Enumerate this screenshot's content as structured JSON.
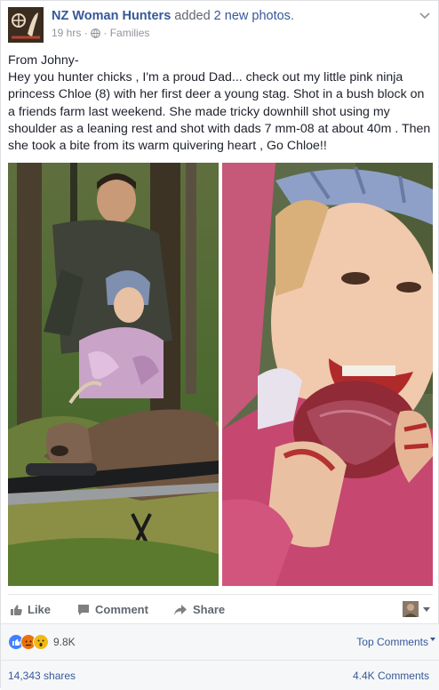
{
  "post": {
    "page_name": "NZ Woman Hunters",
    "verb": " added ",
    "count_text": "2 new photos",
    "period": ".",
    "time": "19 hrs",
    "sep": " · ",
    "audience": " · Families",
    "text_lines": [
      "From Johny-",
      "Hey you hunter chicks , I'm a proud Dad... check out my little pink ninja princess Chloe (8) with her first deer a young stag. Shot in a bush block on a friends farm last weekend. She made tricky downhill shot using my shoulder as a leaning rest and shot with dads 7 mm-08 at about 40m . Then she took a bite from its warm quivering heart , Go Chloe!!"
    ]
  },
  "actions": {
    "like": "Like",
    "comment": "Comment",
    "share": "Share"
  },
  "stats": {
    "reactions_count": "9.8K",
    "top_comments": "Top Comments",
    "shares": "14,343 shares",
    "comments": "4.4K Comments"
  },
  "icons": {
    "like": "thumbs-up-icon",
    "comment": "speech-bubble-icon",
    "share": "share-arrow-icon",
    "globe": "globe-icon",
    "chevron": "chevron-down-icon"
  },
  "colors": {
    "link": "#365899",
    "secondary": "#90949c",
    "action": "#616770",
    "like_reaction": "#4080ff",
    "angry_reaction": "#e9710f",
    "wow_reaction": "#f0ba15"
  }
}
